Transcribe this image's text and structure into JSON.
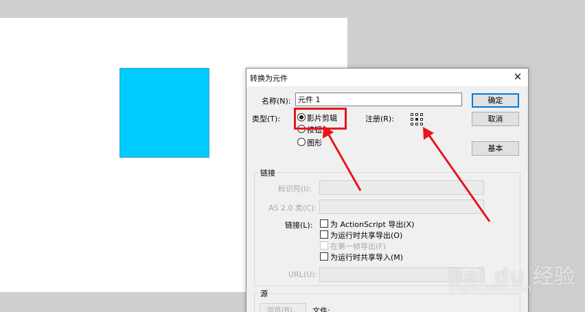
{
  "dialog": {
    "title": "转换为元件",
    "close_glyph": "✕",
    "name_label": "名称(N):",
    "name_value": "元件 1",
    "type_label": "类型(T):",
    "type_options": [
      {
        "label": "影片剪辑",
        "checked": true
      },
      {
        "label": "按钮",
        "checked": false
      },
      {
        "label": "图形",
        "checked": false
      }
    ],
    "registration_label": "注册(R):",
    "buttons": {
      "ok": "确定",
      "cancel": "取消",
      "basic": "基本"
    }
  },
  "linkage": {
    "group_title": "链接",
    "identifier_label": "标识符(I):",
    "as_class_label": "AS 2.0 类(C):",
    "linkage_label": "链接(L):",
    "options": [
      {
        "label": "为 ActionScript 导出(X)",
        "enabled": true
      },
      {
        "label": "为运行时共享导出(O)",
        "enabled": true
      },
      {
        "label": "在第一帧导出(F)",
        "enabled": false
      },
      {
        "label": "为运行时共享导入(M)",
        "enabled": true
      }
    ],
    "url_label": "URL(U):"
  },
  "source": {
    "group_title": "源",
    "browse_label": "浏览(B)...",
    "file_label": "文件:"
  },
  "stage": {
    "shape_color": "#00ccff",
    "background": "#ffffff"
  },
  "annotation": {
    "color": "#e8141c"
  },
  "watermark": {
    "text": "Bai du 经验",
    "sub": "jingyan.baidu.com"
  }
}
